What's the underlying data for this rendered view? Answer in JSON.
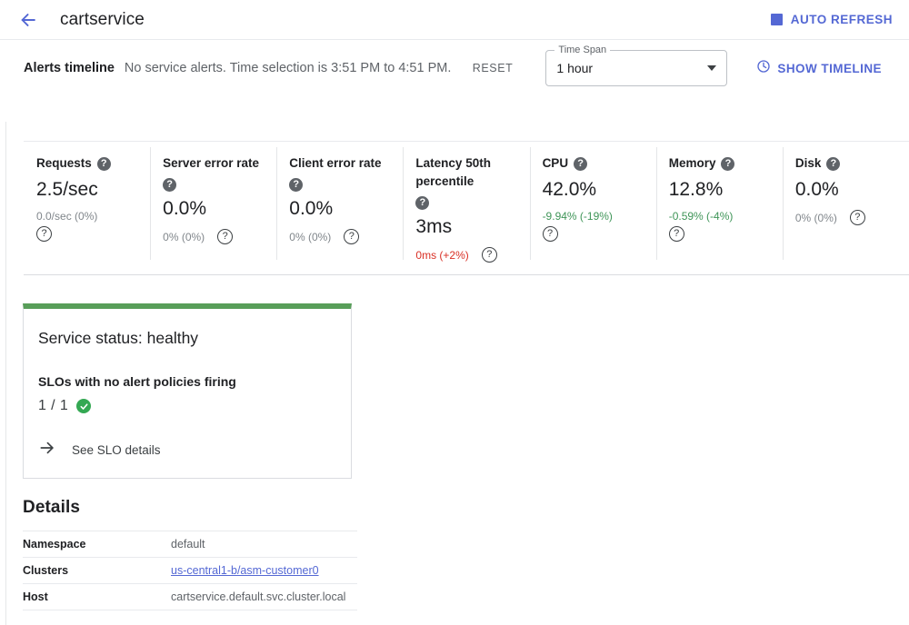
{
  "appbar": {
    "back_icon": "arrow-left-icon",
    "title": "cartservice",
    "auto_refresh_label": "AUTO REFRESH",
    "accent_color": "#5468d4"
  },
  "alerts": {
    "title": "Alerts timeline",
    "message": "No service alerts. Time selection is 3:51 PM to 4:51 PM.",
    "reset_label": "RESET",
    "time_span_legend": "Time Span",
    "time_span_value": "1 hour",
    "time_span_options": [
      "1 hour"
    ],
    "show_timeline_label": "SHOW TIMELINE",
    "clock_icon": "clock-icon"
  },
  "metrics": [
    {
      "label": "Requests",
      "value": "2.5/sec",
      "delta": "0.0/sec (0%)",
      "delta_tone": "neutral",
      "help_icon": "help-filled-icon",
      "info_icon": "help-outline-icon",
      "stacked": true
    },
    {
      "label": "Server error rate",
      "value": "0.0%",
      "delta": "0% (0%)",
      "delta_tone": "neutral",
      "help_icon": "help-filled-icon",
      "info_icon": "help-outline-icon",
      "stacked": false
    },
    {
      "label": "Client error rate",
      "value": "0.0%",
      "delta": "0% (0%)",
      "delta_tone": "neutral",
      "help_icon": "help-filled-icon",
      "info_icon": "help-outline-icon",
      "stacked": false
    },
    {
      "label": "Latency 50th percentile",
      "value": "3ms",
      "delta": "0ms (+2%)",
      "delta_tone": "red",
      "help_icon": "help-filled-icon",
      "info_icon": "help-outline-icon",
      "stacked": false
    },
    {
      "label": "CPU",
      "value": "42.0%",
      "delta": "-9.94% (-19%)",
      "delta_tone": "green",
      "help_icon": "help-filled-icon",
      "info_icon": "help-outline-icon",
      "stacked": true
    },
    {
      "label": "Memory",
      "value": "12.8%",
      "delta": "-0.59% (-4%)",
      "delta_tone": "green",
      "help_icon": "help-filled-icon",
      "info_icon": "help-outline-icon",
      "stacked": true
    },
    {
      "label": "Disk",
      "value": "0.0%",
      "delta": "0% (0%)",
      "delta_tone": "neutral",
      "help_icon": "help-filled-icon",
      "info_icon": "help-outline-icon",
      "stacked": false
    }
  ],
  "status_card": {
    "accent_color": "#589e59",
    "heading": "Service status: healthy",
    "slo_label": "SLOs with no alert policies firing",
    "slo_count": "1 / 1",
    "status_icon": "check-circle-icon",
    "link_label": "See SLO details",
    "link_icon": "arrow-right-icon"
  },
  "details": {
    "title": "Details",
    "rows": [
      {
        "key": "Namespace",
        "value": "default",
        "is_link": false
      },
      {
        "key": "Clusters",
        "value": "us-central1-b/asm-customer0",
        "is_link": true
      },
      {
        "key": "Host",
        "value": "cartservice.default.svc.cluster.local",
        "is_link": false
      }
    ]
  }
}
